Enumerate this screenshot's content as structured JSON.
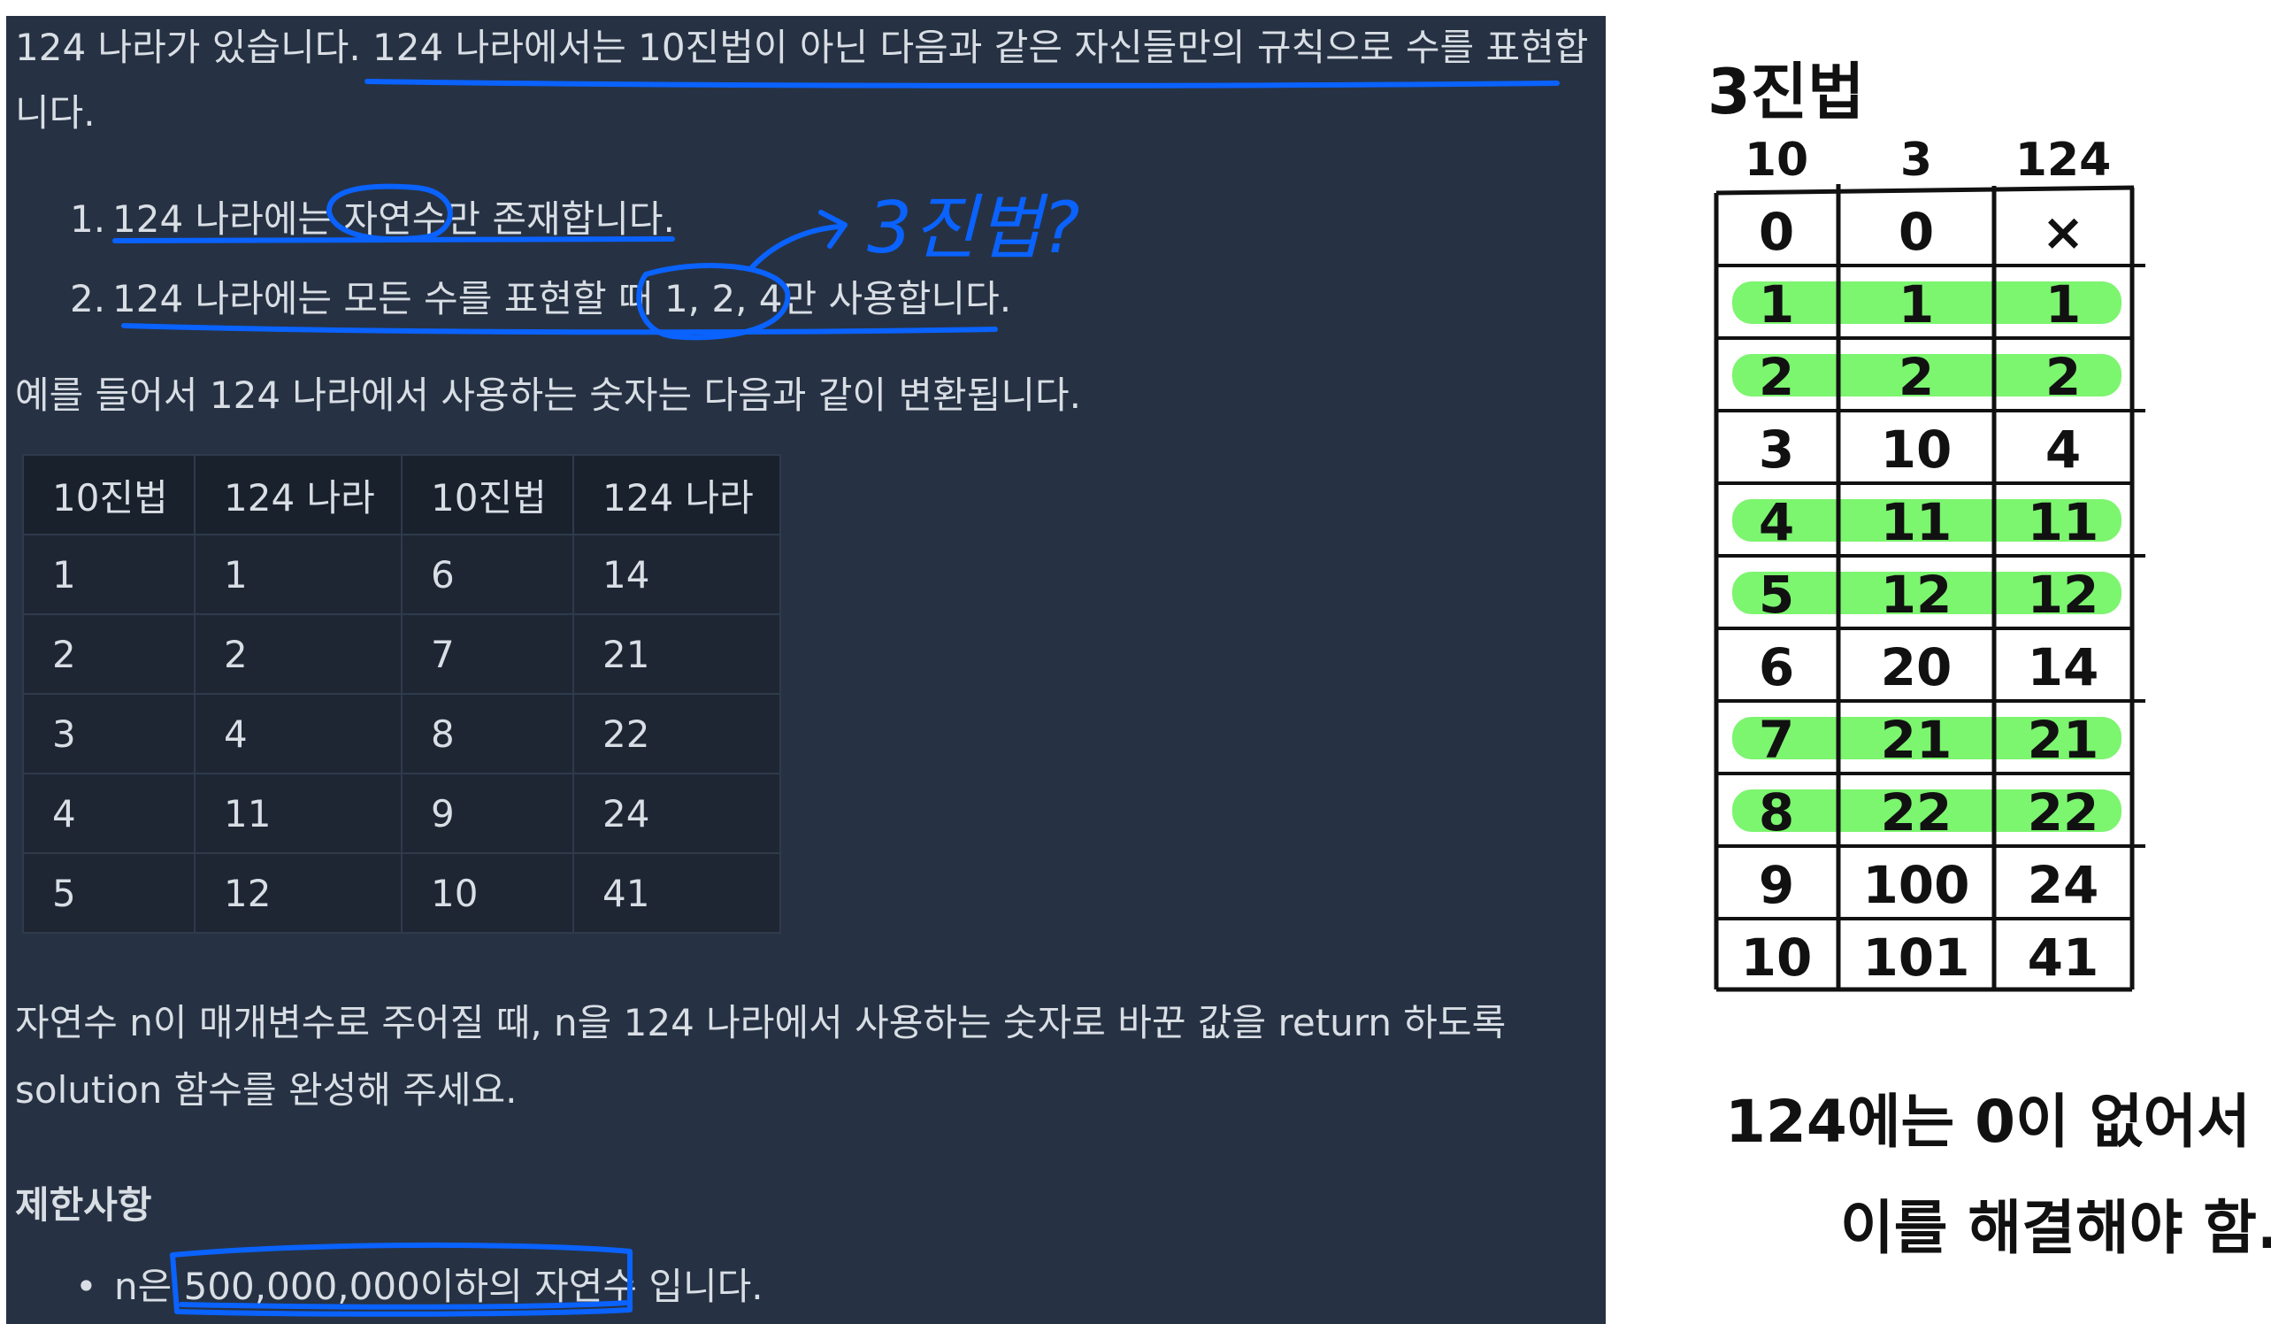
{
  "problem": {
    "intro_line1": "124 나라가 있습니다. 124 나라에서는 10진법이 아닌 다음과 같은 자신들만의 규칙으로 수를 표현합",
    "intro_line2": "니다.",
    "rules": [
      {
        "num": "1.",
        "text": "124 나라에는 자연수만 존재합니다."
      },
      {
        "num": "2.",
        "text": "124 나라에는 모든 수를 표현할 때 1, 2, 4만 사용합니다."
      }
    ],
    "example_intro": "예를 들어서 124 나라에서 사용하는 숫자는 다음과 같이 변환됩니다.",
    "table": {
      "headers": [
        "10진법",
        "124 나라",
        "10진법",
        "124 나라"
      ],
      "rows": [
        [
          "1",
          "1",
          "6",
          "14"
        ],
        [
          "2",
          "2",
          "7",
          "21"
        ],
        [
          "3",
          "4",
          "8",
          "22"
        ],
        [
          "4",
          "11",
          "9",
          "24"
        ],
        [
          "5",
          "12",
          "10",
          "41"
        ]
      ]
    },
    "task_line1": "자연수 n이 매개변수로 주어질 때, n을 124 나라에서 사용하는 숫자로 바꾼 값을 return 하도록",
    "task_line2": "solution 함수를 완성해 주세요.",
    "constraints_title": "제한사항",
    "constraint_item": "n은 500,000,000이하의 자연수 입니다."
  },
  "annotation": {
    "blue_note": "3진법?"
  },
  "notes": {
    "title": "3진법",
    "headers": [
      "10",
      "3",
      "124"
    ],
    "rows": [
      [
        "0",
        "0",
        "×"
      ],
      [
        "1",
        "1",
        "1"
      ],
      [
        "2",
        "2",
        "2"
      ],
      [
        "3",
        "10",
        "4"
      ],
      [
        "4",
        "11",
        "11"
      ],
      [
        "5",
        "12",
        "12"
      ],
      [
        "6",
        "20",
        "14"
      ],
      [
        "7",
        "21",
        "21"
      ],
      [
        "8",
        "22",
        "22"
      ],
      [
        "9",
        "100",
        "24"
      ],
      [
        "10",
        "101",
        "41"
      ]
    ],
    "comment_line1": "124에는 0이 없어서",
    "comment_line2": "이를 해결해야 함."
  },
  "colors": {
    "panel_bg": "#263243",
    "table_bg": "#1e2634",
    "text": "#d9dee5",
    "pen_blue": "#0a62ff",
    "highlight_green": "#7cf56f",
    "ink": "#111111"
  }
}
